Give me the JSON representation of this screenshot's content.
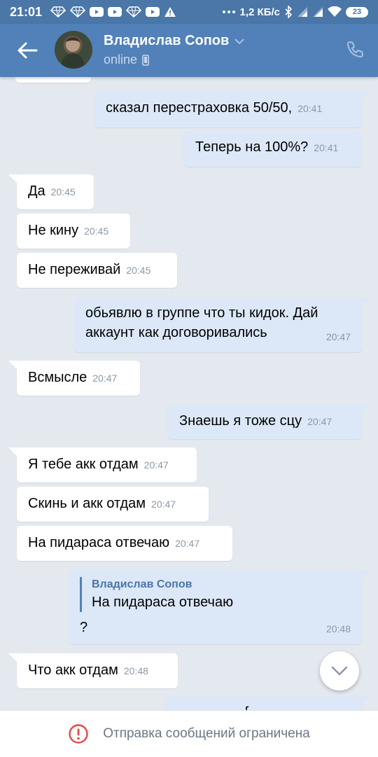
{
  "status_bar": {
    "time": "21:01",
    "speed": "1,2 КБ/с",
    "battery": "23",
    "icons": [
      "gem-icon",
      "gem-icon",
      "youtube-icon",
      "youtube-icon",
      "gem-icon",
      "youtube-icon",
      "warning-icon",
      "more-icon",
      "bluetooth-icon",
      "signal-icon",
      "signal-icon",
      "wifi-icon",
      "battery-icon"
    ]
  },
  "header": {
    "name": "Владислав Сопов",
    "status": "online",
    "colors": {
      "bar": "#5181b8",
      "status_bar": "#4a76a8"
    }
  },
  "messages": [
    {
      "dir": "out",
      "text": "сказал перестраховка 50/50,",
      "time": "20:41"
    },
    {
      "dir": "out",
      "text": "Теперь на 100%?",
      "time": "20:41"
    },
    {
      "dir": "in",
      "text": "Да",
      "time": "20:45"
    },
    {
      "dir": "in",
      "text": "Не кину",
      "time": "20:45"
    },
    {
      "dir": "in",
      "text": "Не переживай",
      "time": "20:45"
    },
    {
      "dir": "out",
      "text": "обьявлю в группе что ты кидок. Дай аккаунт как договоривались",
      "time": "20:47"
    },
    {
      "dir": "in",
      "text": "Всмысле",
      "time": "20:47"
    },
    {
      "dir": "out",
      "text": "Знаешь я тоже сцу",
      "time": "20:47"
    },
    {
      "dir": "in",
      "text": "Я тебе акк отдам",
      "time": "20:47"
    },
    {
      "dir": "in",
      "text": "Скинь и акк отдам",
      "time": "20:47"
    },
    {
      "dir": "in",
      "text": "На пидараса отвечаю",
      "time": "20:47"
    },
    {
      "dir": "out",
      "reply_author": "Владислав Сопов",
      "reply_text": "На пидараса отвечаю",
      "text": "?",
      "time": "20:48"
    },
    {
      "dir": "in",
      "text": "Что акк отдам",
      "time": "20:48"
    }
  ],
  "bottom_bar": {
    "text": "Отправка сообщений ограничена",
    "icon": "alert-circle-icon",
    "icon_color": "#e64646"
  }
}
